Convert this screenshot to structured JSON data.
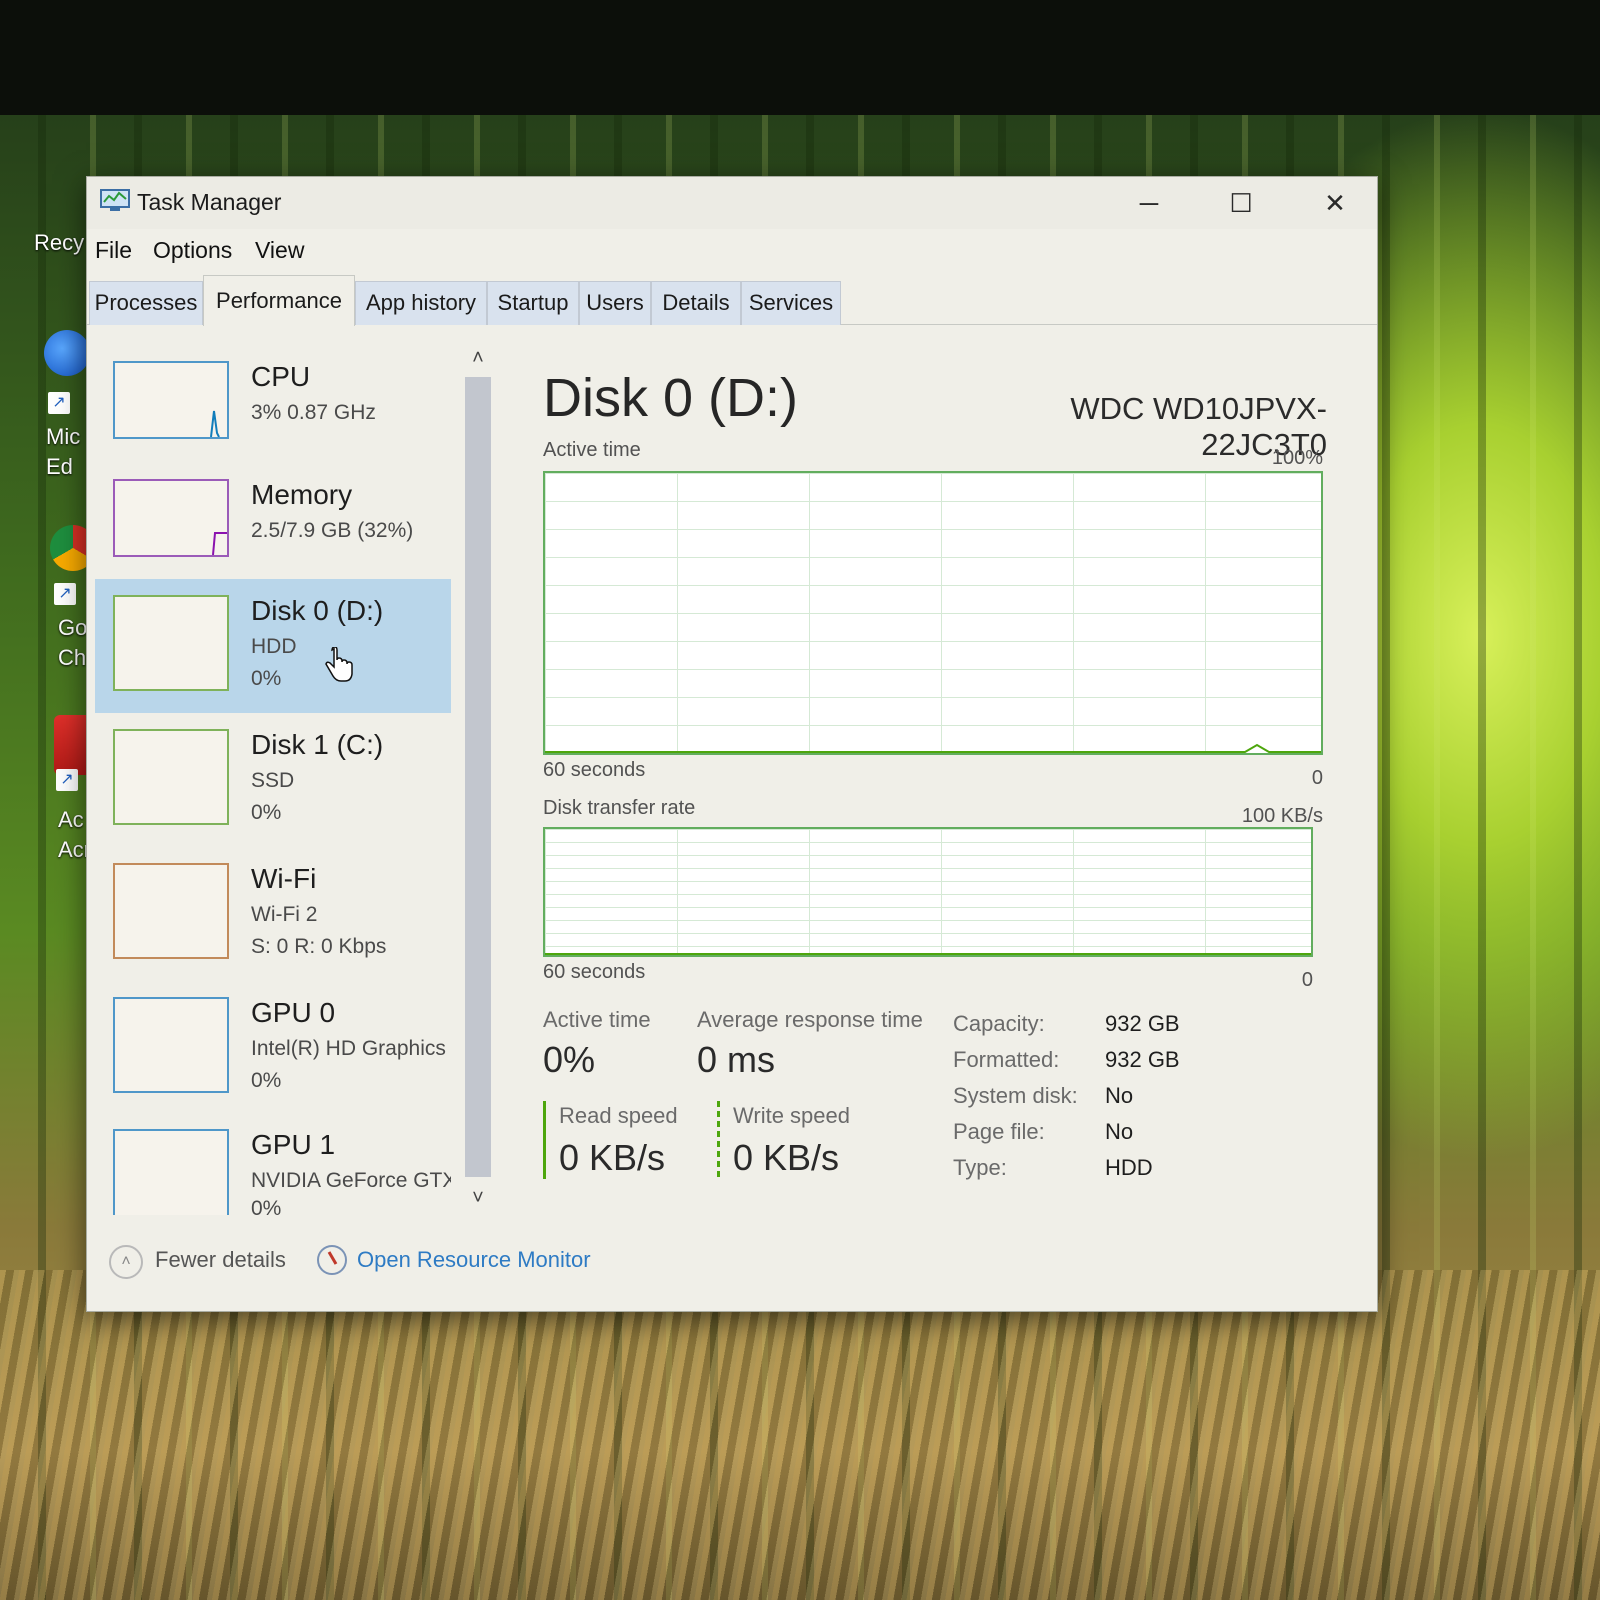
{
  "desktop": {
    "icons": [
      {
        "label": "Recy"
      },
      {
        "label": "Mic\nEd"
      },
      {
        "label": "Go\nChr"
      },
      {
        "label": "Ac\nAcr"
      }
    ]
  },
  "window": {
    "title": "Task Manager",
    "controls": {
      "minimize": "─",
      "maximize": "☐",
      "close": "✕"
    }
  },
  "menu": {
    "file": "File",
    "options": "Options",
    "view": "View"
  },
  "tabs": [
    {
      "label": "Processes"
    },
    {
      "label": "Performance",
      "active": true
    },
    {
      "label": "App history"
    },
    {
      "label": "Startup"
    },
    {
      "label": "Users"
    },
    {
      "label": "Details"
    },
    {
      "label": "Services"
    }
  ],
  "devices": [
    {
      "name": "CPU",
      "sub": "3%  0.87 GHz",
      "sub2": "",
      "color": "#117dbb"
    },
    {
      "name": "Memory",
      "sub": "2.5/7.9 GB (32%)",
      "sub2": "",
      "color": "#8b12ae"
    },
    {
      "name": "Disk 0 (D:)",
      "sub": "HDD",
      "sub2": "0%",
      "color": "#4da60c",
      "selected": true
    },
    {
      "name": "Disk 1 (C:)",
      "sub": "SSD",
      "sub2": "0%",
      "color": "#4da60c"
    },
    {
      "name": "Wi-Fi",
      "sub": "Wi-Fi 2",
      "sub2": "S: 0  R: 0 Kbps",
      "color": "#a74f01"
    },
    {
      "name": "GPU 0",
      "sub": "Intel(R) HD Graphics",
      "sub2": "0%",
      "color": "#117dbb"
    },
    {
      "name": "GPU 1",
      "sub": "NVIDIA GeForce GTX",
      "sub2": "0%",
      "color": "#117dbb"
    }
  ],
  "detail": {
    "title": "Disk 0 (D:)",
    "model": "WDC WD10JPVX-22JC3T0",
    "graphs": {
      "active_time": {
        "label": "Active time",
        "max": "100%",
        "time": "60 seconds",
        "min": "0"
      },
      "transfer": {
        "label": "Disk transfer rate",
        "max": "100 KB/s",
        "time": "60 seconds",
        "min": "0"
      }
    },
    "stats": {
      "active_time_label": "Active time",
      "active_time_value": "0%",
      "avg_response_label": "Average response time",
      "avg_response_value": "0 ms",
      "read_label": "Read speed",
      "read_value": "0 KB/s",
      "write_label": "Write speed",
      "write_value": "0 KB/s"
    },
    "properties": [
      {
        "label": "Capacity:",
        "value": "932 GB"
      },
      {
        "label": "Formatted:",
        "value": "932 GB"
      },
      {
        "label": "System disk:",
        "value": "No"
      },
      {
        "label": "Page file:",
        "value": "No"
      },
      {
        "label": "Type:",
        "value": "HDD"
      }
    ],
    "accent": "#4da60c"
  },
  "footer": {
    "fewer_details": "Fewer details",
    "open_resource_monitor": "Open Resource Monitor"
  }
}
